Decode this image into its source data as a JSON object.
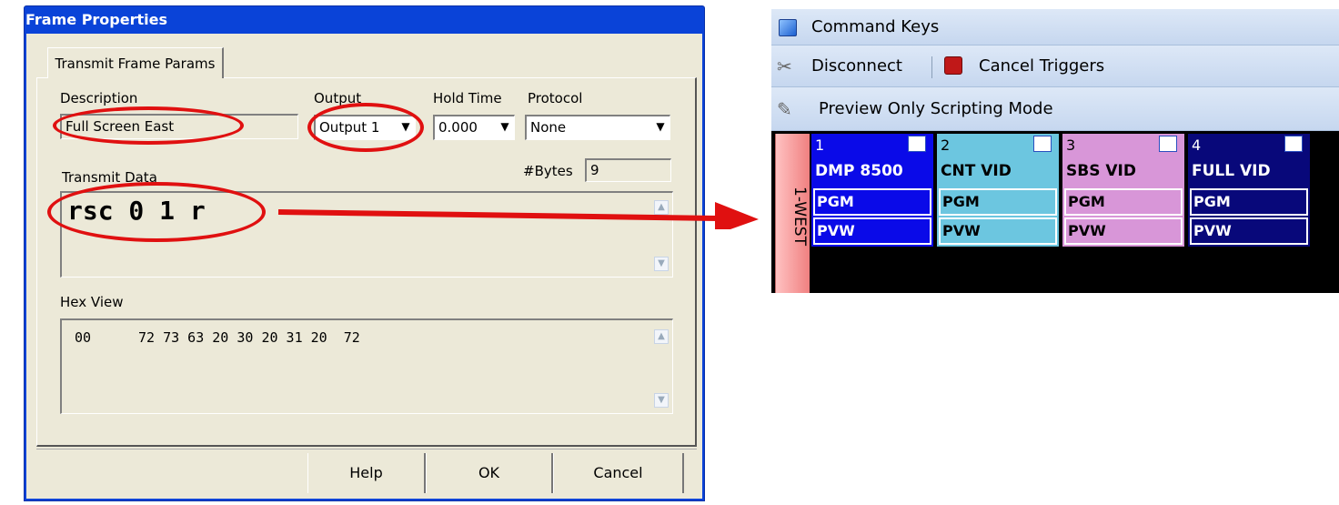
{
  "dialog": {
    "title": "Frame Properties",
    "tab": "Transmit Frame Params",
    "description_label": "Description",
    "description_value": "Full Screen East",
    "output_label": "Output",
    "output_value": "Output 1",
    "hold_time_label": "Hold Time",
    "hold_time_value": "0.000",
    "protocol_label": "Protocol",
    "protocol_value": "None",
    "transmit_label": "Transmit Data",
    "bytes_label": "#Bytes",
    "bytes_value": "9",
    "transmit_value": "rsc 0 1 r",
    "hex_label": "Hex View",
    "hex_offset": "00",
    "hex_bytes": "72 73 63 20 30 20 31 20  72",
    "buttons": {
      "help": "Help",
      "ok": "OK",
      "cancel": "Cancel"
    }
  },
  "command_keys": {
    "title": "Command Keys",
    "disconnect": "Disconnect",
    "cancel_triggers": "Cancel Triggers",
    "preview_mode": "Preview Only Scripting Mode",
    "side_tab": "1-WEST",
    "tiles": [
      {
        "num": "1",
        "name": "DMP 8500",
        "pgm": "PGM",
        "pvw": "PVW",
        "color": "#0a0ae8",
        "text": "#ffffff"
      },
      {
        "num": "2",
        "name": "CNT VID",
        "pgm": "PGM",
        "pvw": "PVW",
        "color": "#6cc6e0",
        "text": "#000000"
      },
      {
        "num": "3",
        "name": "SBS VID",
        "pgm": "PGM",
        "pvw": "PVW",
        "color": "#d896d8",
        "text": "#000000"
      },
      {
        "num": "4",
        "name": "FULL VID",
        "pgm": "PGM",
        "pvw": "PVW",
        "color": "#08087a",
        "text": "#ffffff"
      }
    ]
  },
  "colors": {
    "annotation": "#e01010",
    "title_bar": "#0a43d8",
    "dialog_face": "#ece9d8"
  }
}
